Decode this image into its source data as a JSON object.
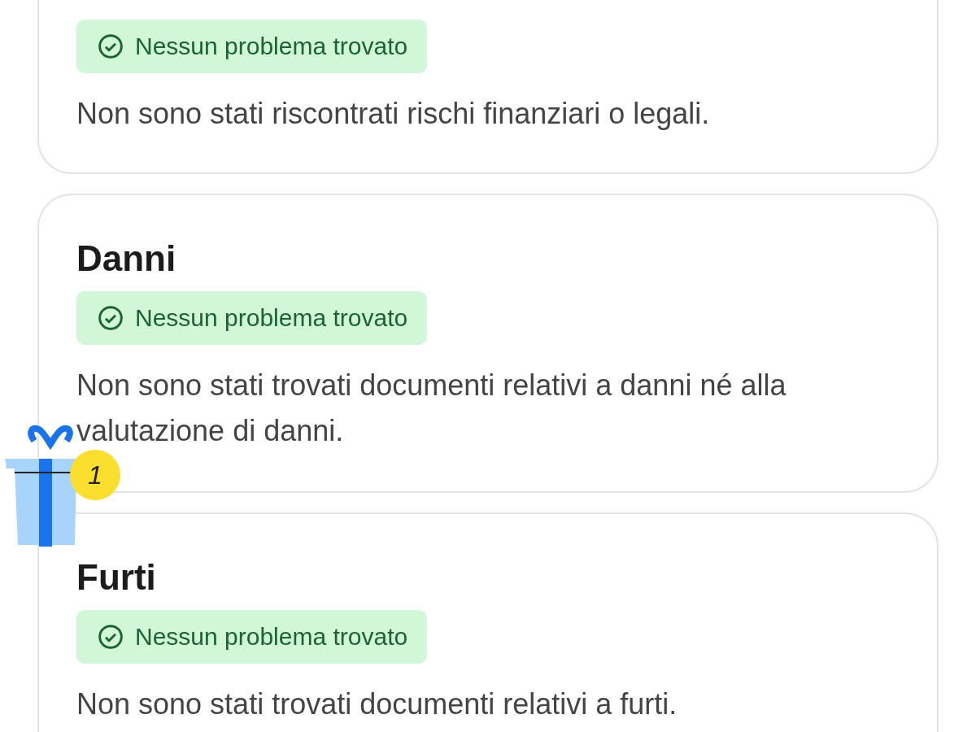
{
  "sections": [
    {
      "status": {
        "kind": "ok",
        "label": "Nessun problema trovato"
      },
      "description": "Non sono stati riscontrati rischi finanziari o legali."
    },
    {
      "title": "Danni",
      "status": {
        "kind": "ok",
        "label": "Nessun problema trovato"
      },
      "description": "Non sono stati trovati documenti relativi a danni né alla valutazione di danni."
    },
    {
      "title": "Furti",
      "status": {
        "kind": "ok",
        "label": "Nessun problema trovato"
      },
      "description": "Non sono stati trovati documenti relativi a furti."
    }
  ],
  "gift": {
    "count": "1"
  }
}
